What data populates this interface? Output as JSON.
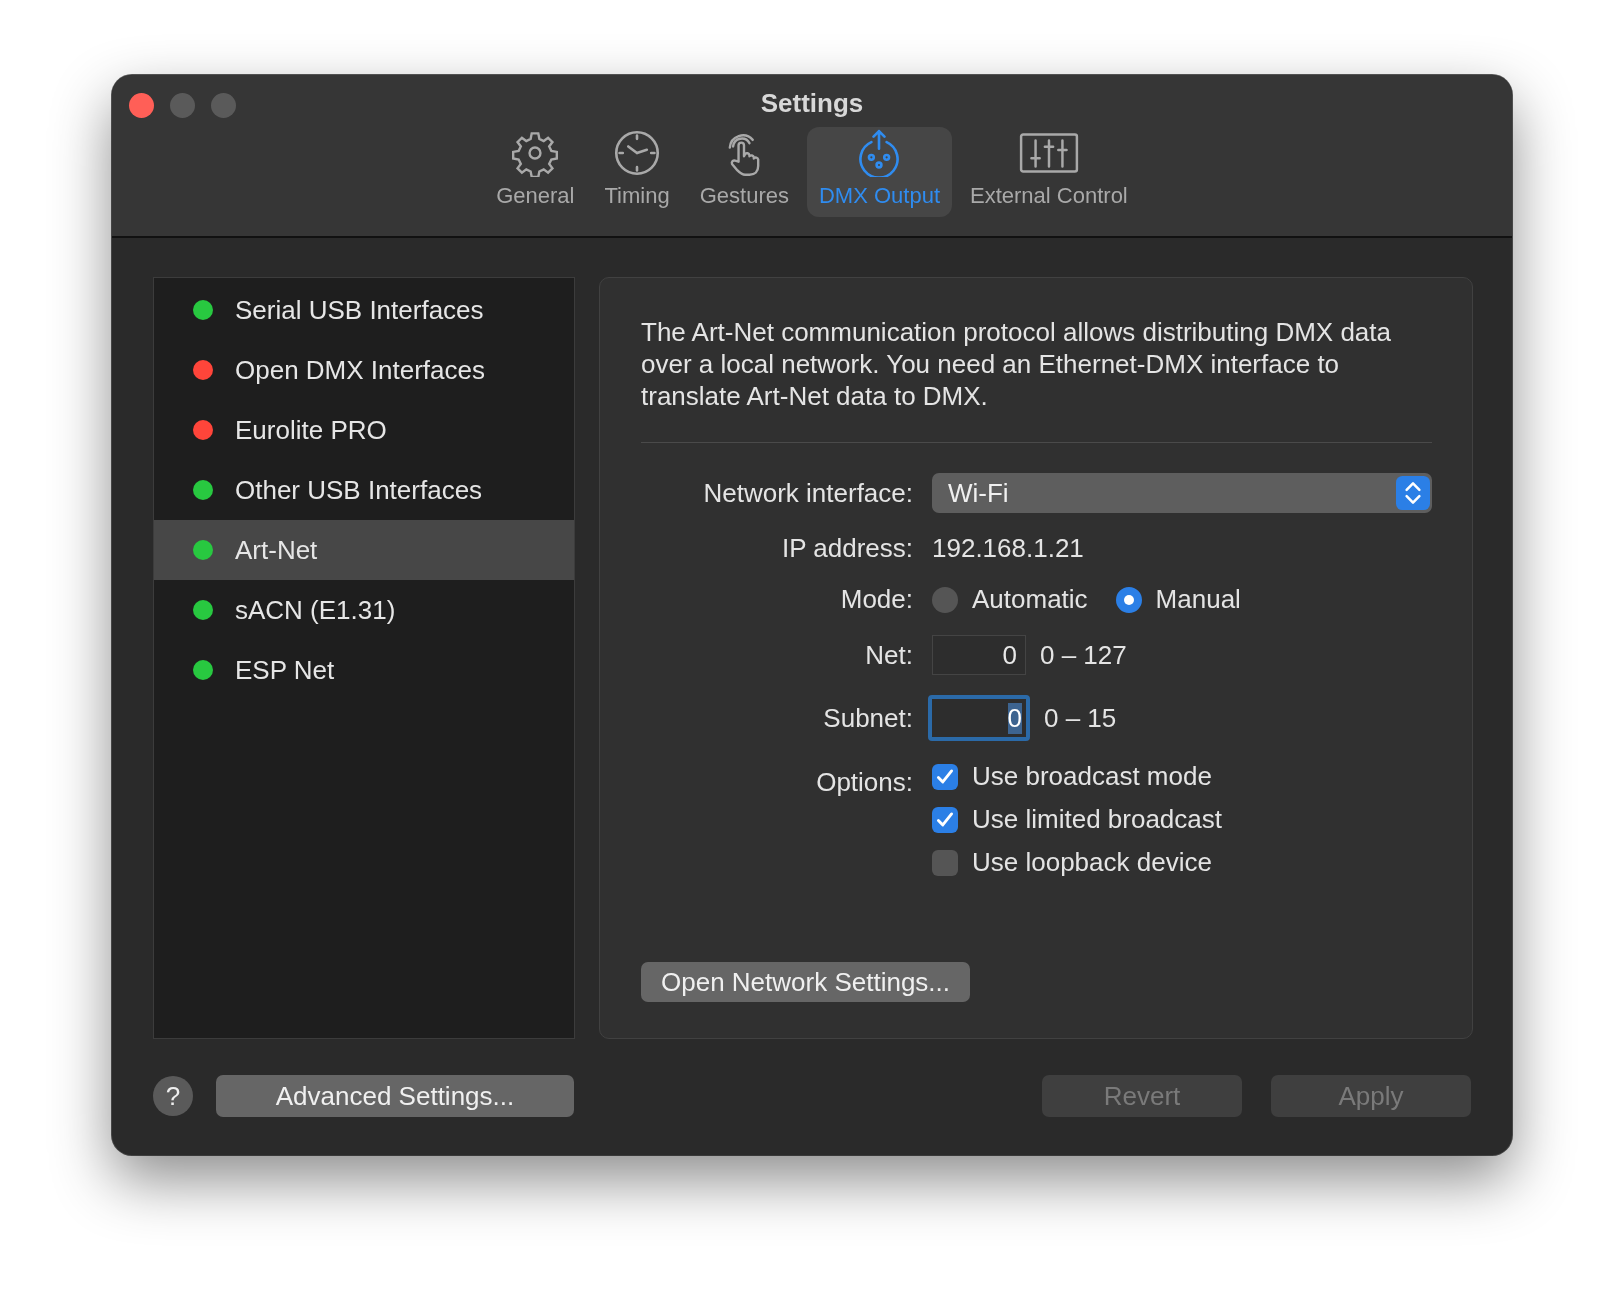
{
  "window": {
    "title": "Settings"
  },
  "tabs": [
    {
      "label": "General",
      "kind": "gear",
      "selected": false
    },
    {
      "label": "Timing",
      "kind": "clock",
      "selected": false
    },
    {
      "label": "Gestures",
      "kind": "hand",
      "selected": false
    },
    {
      "label": "DMX Output",
      "kind": "dmx",
      "selected": true
    },
    {
      "label": "External Control",
      "kind": "sliders",
      "selected": false
    }
  ],
  "sidebar": {
    "items": [
      {
        "label": "Serial USB Interfaces",
        "color": "#28c840",
        "selected": false
      },
      {
        "label": "Open DMX Interfaces",
        "color": "#ff453a",
        "selected": false
      },
      {
        "label": "Eurolite PRO",
        "color": "#ff453a",
        "selected": false
      },
      {
        "label": "Other USB Interfaces",
        "color": "#28c840",
        "selected": false
      },
      {
        "label": "Art-Net",
        "color": "#28c840",
        "selected": true
      },
      {
        "label": "sACN (E1.31)",
        "color": "#28c840",
        "selected": false
      },
      {
        "label": "ESP Net",
        "color": "#28c840",
        "selected": false
      }
    ]
  },
  "panel": {
    "description": "The Art-Net communication protocol allows distributing DMX data over a local network. You need an Ethernet-DMX interface to translate Art-Net data to DMX.",
    "network_interface": {
      "label": "Network interface:",
      "value": "Wi-Fi"
    },
    "ip_address": {
      "label": "IP address:",
      "value": "192.168.1.21"
    },
    "mode": {
      "label": "Mode:",
      "options": [
        {
          "label": "Automatic",
          "selected": false
        },
        {
          "label": "Manual",
          "selected": true
        }
      ]
    },
    "net": {
      "label": "Net:",
      "value": "0",
      "range": "0 – 127",
      "focused": false
    },
    "subnet": {
      "label": "Subnet:",
      "value": "0",
      "range": "0 – 15",
      "focused": true
    },
    "options": {
      "label": "Options:",
      "items": [
        {
          "label": "Use broadcast mode",
          "checked": true
        },
        {
          "label": "Use limited broadcast",
          "checked": true
        },
        {
          "label": "Use loopback device",
          "checked": false
        }
      ]
    },
    "button": "Open Network Settings..."
  },
  "help_button": "?",
  "buttons": [
    {
      "label": "Advanced Settings...",
      "disabled": false
    },
    {
      "label": "Revert",
      "disabled": true
    },
    {
      "label": "Apply",
      "disabled": true
    }
  ]
}
